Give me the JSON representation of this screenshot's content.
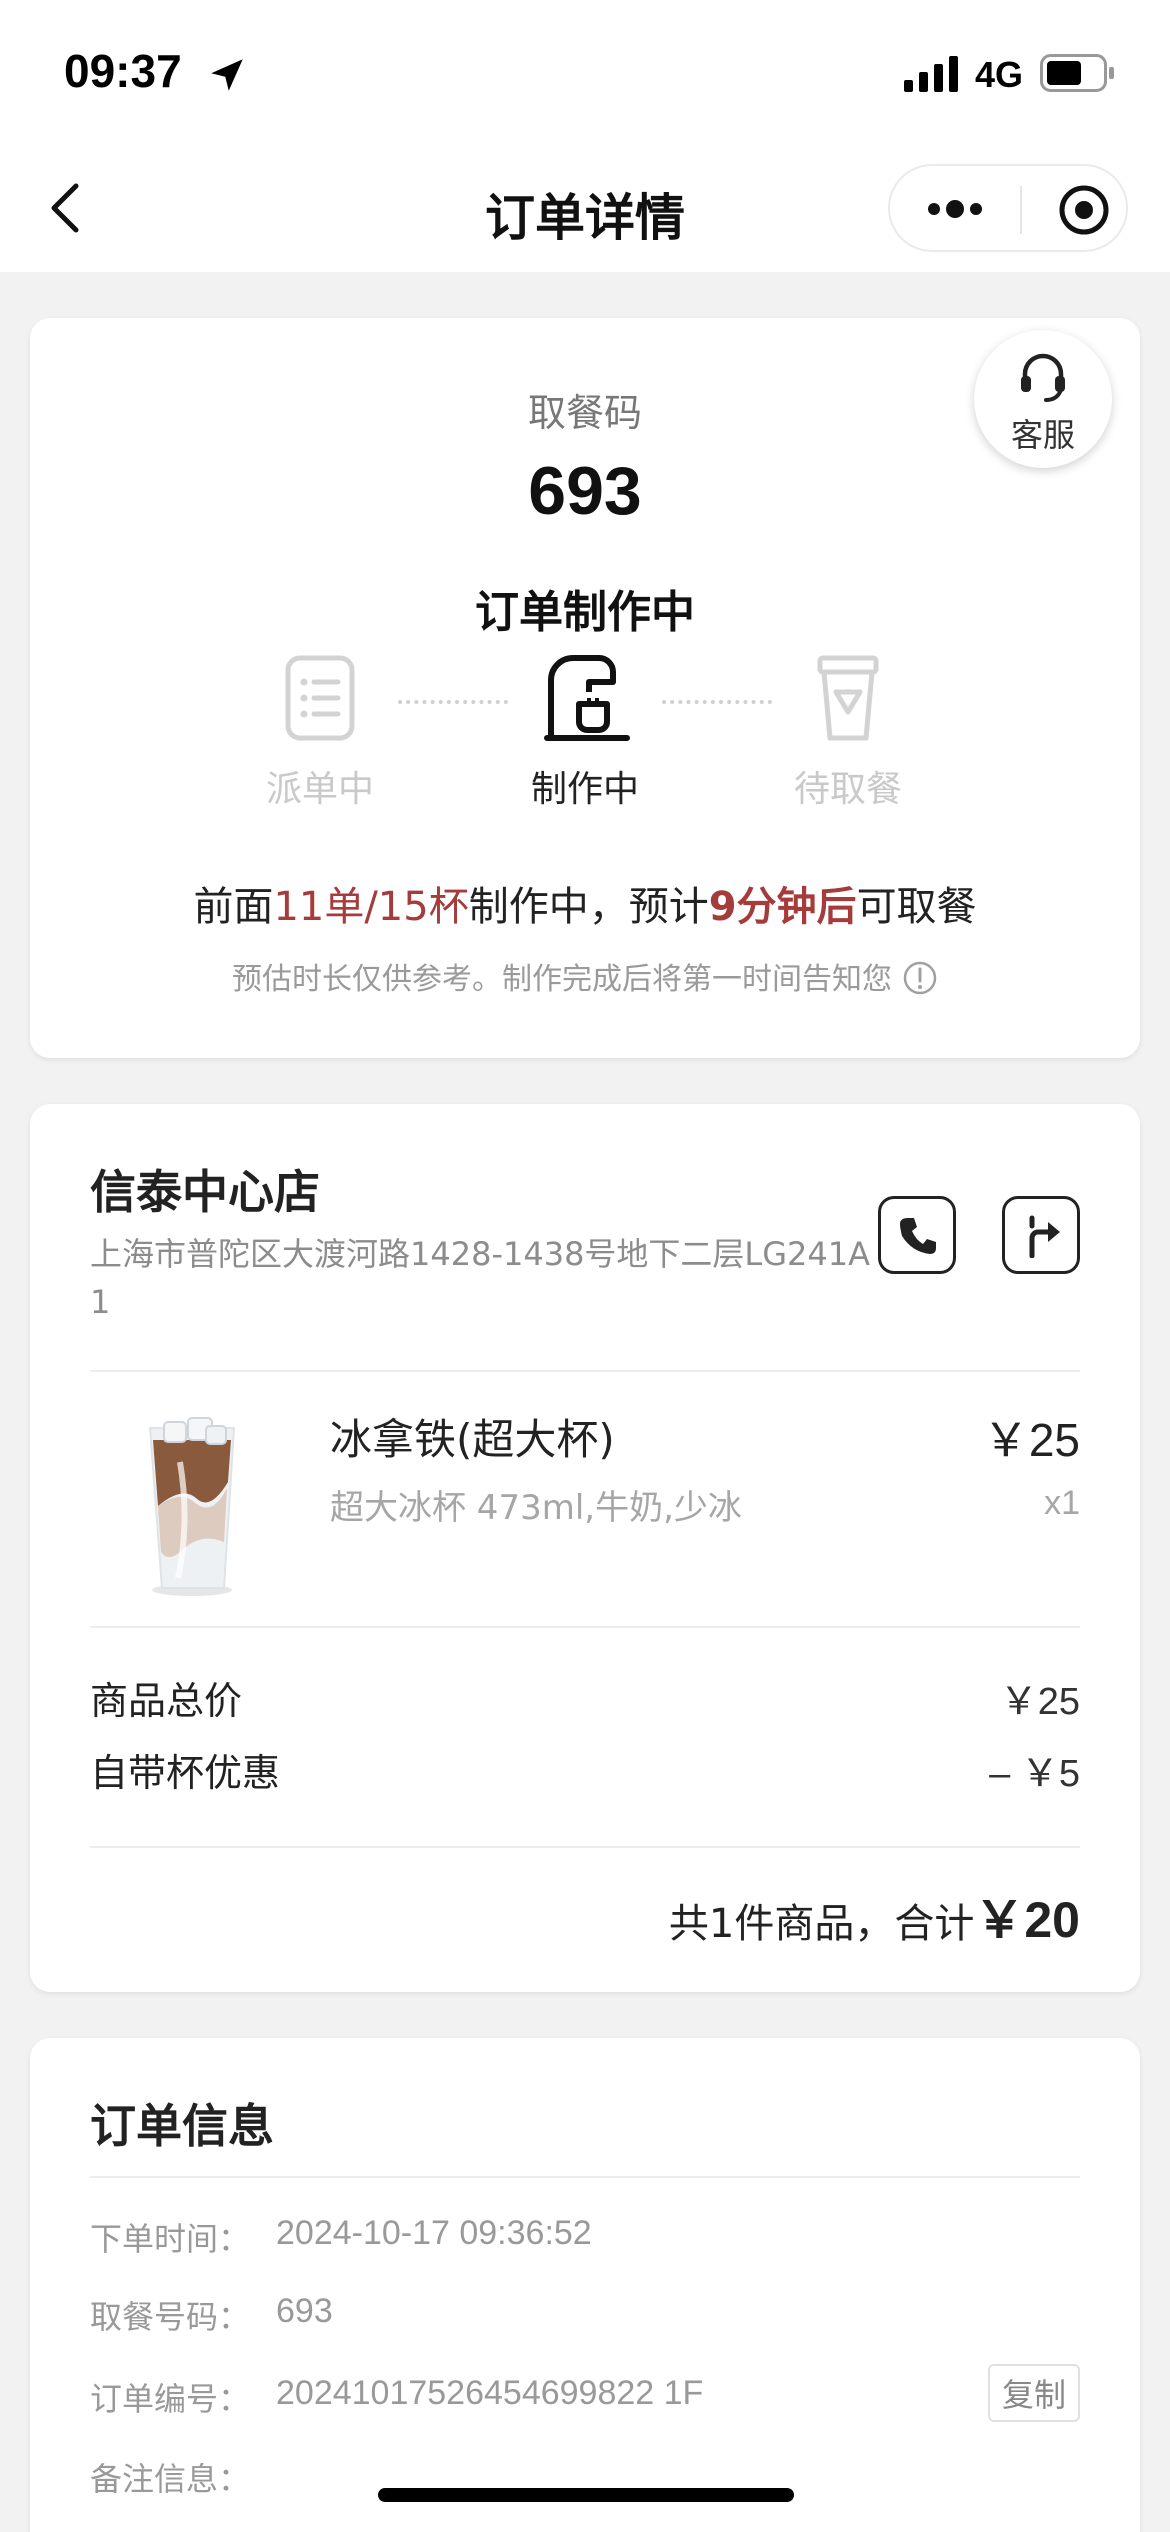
{
  "status_bar": {
    "time": "09:37",
    "network": "4G"
  },
  "nav": {
    "title": "订单详情"
  },
  "pickup": {
    "service_label": "客服",
    "code_label": "取餐码",
    "code": "693",
    "status": "订单制作中",
    "steps": [
      {
        "label": "派单中",
        "active": false
      },
      {
        "label": "制作中",
        "active": true
      },
      {
        "label": "待取餐",
        "active": false
      }
    ],
    "queue": {
      "prefix": "前面",
      "count": "11单/15杯",
      "middle": "制作中，预计",
      "eta": "9分钟后",
      "suffix": "可取餐"
    },
    "note": "预估时长仅供参考。制作完成后将第一时间告知您"
  },
  "store": {
    "name": "信泰中心店",
    "address": "上海市普陀区大渡河路1428-1438号地下二层LG241A1",
    "product": {
      "name": "冰拿铁(超大杯)",
      "spec": "超大冰杯 473ml,牛奶,少冰",
      "price": "￥25",
      "qty": "x1"
    },
    "fees": [
      {
        "label": "商品总价",
        "value": "￥25"
      },
      {
        "label": "自带杯优惠",
        "value": "– ￥5"
      }
    ],
    "total": {
      "label": "共1件商品，合计",
      "amount": "￥20"
    }
  },
  "order_info": {
    "title": "订单信息",
    "rows": [
      {
        "key": "下单时间：",
        "value": "2024-10-17 09:36:52"
      },
      {
        "key": "取餐号码：",
        "value": "693"
      },
      {
        "key": "订单编号：",
        "value": "20241017526454699822 1F"
      },
      {
        "key": "备注信息：",
        "value": ""
      }
    ],
    "copy_label": "复制"
  },
  "colors": {
    "highlight": "#a53b3b",
    "background": "#f2f2f2"
  }
}
